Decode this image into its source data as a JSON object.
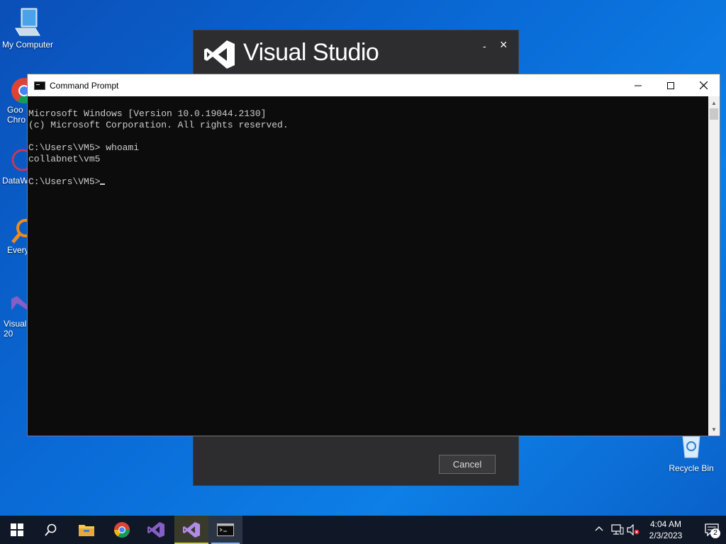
{
  "desktop": {
    "icons": [
      {
        "label": "My Computer"
      },
      {
        "label": "Goo\nChro"
      },
      {
        "label": "DataW"
      },
      {
        "label": "Every"
      },
      {
        "label": "Visual\n20"
      },
      {
        "label": "Recycle Bin"
      }
    ]
  },
  "vs_window": {
    "title": "Visual Studio",
    "minimize": "-",
    "close": "×",
    "cancel_label": "Cancel"
  },
  "cmd": {
    "title": "Command Prompt",
    "lines": [
      "Microsoft Windows [Version 10.0.19044.2130]",
      "(c) Microsoft Corporation. All rights reserved.",
      "",
      "C:\\Users\\VM5> whoami",
      "collabnet\\vm5",
      "",
      "C:\\Users\\VM5>"
    ]
  },
  "taskbar": {
    "time": "4:04 AM",
    "date": "2/3/2023",
    "notification_count": "2"
  },
  "colors": {
    "accent": "#0a6ad6",
    "vs_purple": "#865fc5",
    "console_bg": "#0c0c0c"
  }
}
